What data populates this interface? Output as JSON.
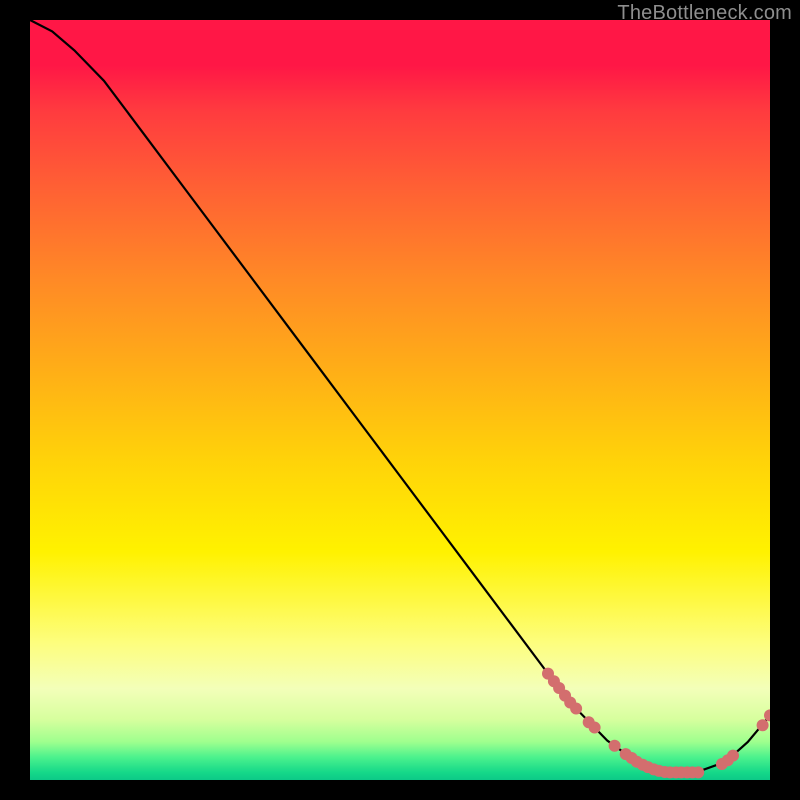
{
  "watermark": "TheBottleneck.com",
  "chart_data": {
    "type": "line",
    "title": "",
    "xlabel": "",
    "ylabel": "",
    "xlim": [
      0,
      100
    ],
    "ylim": [
      0,
      100
    ],
    "grid": false,
    "legend": false,
    "series": [
      {
        "name": "curve",
        "x": [
          0,
          3,
          6,
          10,
          15,
          20,
          25,
          30,
          35,
          40,
          45,
          50,
          55,
          60,
          65,
          70,
          74,
          78,
          82,
          86,
          90,
          94,
          97,
          100
        ],
        "y": [
          100,
          98.5,
          96,
          92,
          85.5,
          79,
          72.5,
          66,
          59.5,
          53,
          46.5,
          40,
          33.5,
          27,
          20.5,
          14,
          9.2,
          5.2,
          2.4,
          1.0,
          1.0,
          2.4,
          5.0,
          8.5
        ]
      }
    ],
    "markers": [
      {
        "x": 70.0,
        "y": 14.0
      },
      {
        "x": 70.8,
        "y": 13.0
      },
      {
        "x": 71.5,
        "y": 12.1
      },
      {
        "x": 72.3,
        "y": 11.1
      },
      {
        "x": 73.0,
        "y": 10.2
      },
      {
        "x": 73.8,
        "y": 9.4
      },
      {
        "x": 75.5,
        "y": 7.6
      },
      {
        "x": 76.3,
        "y": 6.9
      },
      {
        "x": 79.0,
        "y": 4.5
      },
      {
        "x": 80.5,
        "y": 3.4
      },
      {
        "x": 81.3,
        "y": 2.9
      },
      {
        "x": 82.0,
        "y": 2.4
      },
      {
        "x": 82.8,
        "y": 2.0
      },
      {
        "x": 83.5,
        "y": 1.7
      },
      {
        "x": 84.3,
        "y": 1.4
      },
      {
        "x": 85.0,
        "y": 1.2
      },
      {
        "x": 85.8,
        "y": 1.05
      },
      {
        "x": 86.5,
        "y": 1.0
      },
      {
        "x": 87.3,
        "y": 1.0
      },
      {
        "x": 88.0,
        "y": 1.0
      },
      {
        "x": 88.8,
        "y": 1.0
      },
      {
        "x": 89.5,
        "y": 1.0
      },
      {
        "x": 90.3,
        "y": 1.0
      },
      {
        "x": 93.5,
        "y": 2.1
      },
      {
        "x": 94.3,
        "y": 2.6
      },
      {
        "x": 95.0,
        "y": 3.2
      },
      {
        "x": 99.0,
        "y": 7.2
      },
      {
        "x": 100.0,
        "y": 8.5
      }
    ],
    "curve_color": "#000000",
    "marker_color": "#d36e6e",
    "marker_radius": 6
  }
}
